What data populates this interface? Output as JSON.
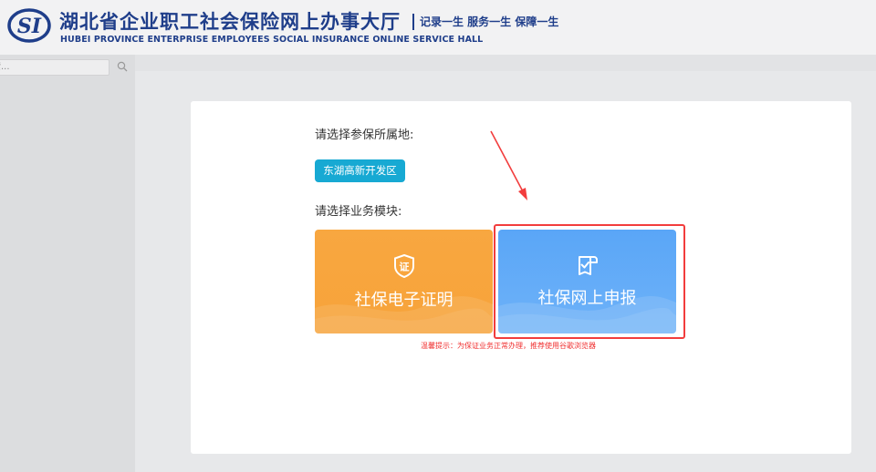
{
  "header": {
    "title_cn": "湖北省企业职工社会保险网上办事大厅",
    "title_en": "HUBEI PROVINCE ENTERPRISE EMPLOYEES SOCIAL INSURANCE ONLINE SERVICE HALL",
    "slogan": "记录一生 服务一生 保障一生",
    "logo_text": "SI"
  },
  "sidebar": {
    "search_placeholder": "输入菜单名称快速检索..."
  },
  "modal": {
    "location_label": "请选择参保所属地:",
    "region_button": "东湖高新开发区",
    "business_label": "请选择业务模块:",
    "cards": [
      {
        "label": "社保电子证明",
        "icon": "certificate-icon",
        "color": "#f8a740"
      },
      {
        "label": "社保网上申报",
        "icon": "declare-icon",
        "color": "#5aa6f7"
      }
    ],
    "tip": "温馨提示：为保证业务正常办理，推荐使用谷歌浏览器"
  },
  "colors": {
    "brand": "#1f3e8a",
    "highlight": "#f23d3d",
    "region_button": "#17a9d3"
  }
}
